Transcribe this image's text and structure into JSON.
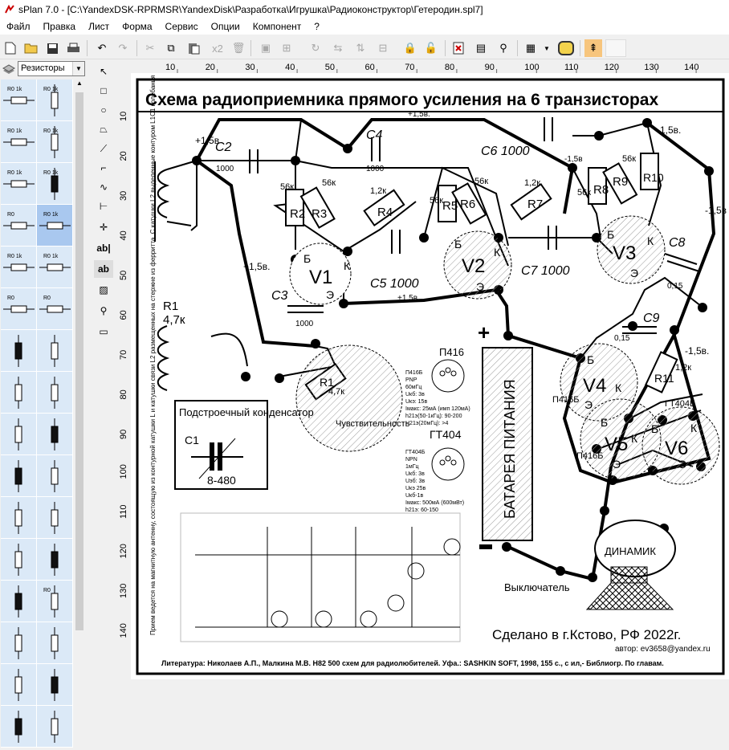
{
  "window": {
    "title": "sPlan 7.0 - [C:\\YandexDSK-RPRMSR\\YandexDisk\\Разработка\\Игрушка\\Радиоконструктор\\Гетеродин.spl7]"
  },
  "menu": [
    "Файл",
    "Правка",
    "Лист",
    "Форма",
    "Сервис",
    "Опции",
    "Компонент",
    "?"
  ],
  "toolbar": {
    "multiply_label": "x2"
  },
  "library": {
    "selected": "Резисторы"
  },
  "left_palette": [
    [
      "R0 1k",
      "R0 1k"
    ],
    [
      "R0 1k",
      "R0 1k"
    ],
    [
      "R0 1k",
      "R0 1k"
    ],
    [
      "R0",
      "R0 1k"
    ],
    [
      "R0 1k",
      "R0 1k"
    ],
    [
      "R0",
      "R0"
    ],
    [
      "",
      ""
    ],
    [
      "",
      ""
    ],
    [
      "",
      ""
    ],
    [
      "",
      ""
    ],
    [
      "",
      ""
    ],
    [
      "",
      ""
    ],
    [
      "",
      "R0"
    ],
    [
      "",
      ""
    ],
    [
      "",
      ""
    ],
    [
      "",
      ""
    ]
  ],
  "rulers": {
    "h": [
      "10",
      "20",
      "30",
      "40",
      "50",
      "60",
      "70",
      "80",
      "90",
      "100",
      "110",
      "120",
      "130",
      "140"
    ],
    "v": [
      "10",
      "20",
      "30",
      "40",
      "50",
      "60",
      "70",
      "80",
      "90",
      "100",
      "110",
      "120",
      "130",
      "140"
    ]
  },
  "schematic": {
    "title": "Схема радиоприемника прямого усиления на 6 транзисторах",
    "supply_top": "+1,5в.",
    "labels": {
      "c2": "C2",
      "c2v": "1000",
      "c4": "C4",
      "c4v": "1000",
      "c6": "C6 1000",
      "c6v": "-1,5в",
      "r2": "R2",
      "r2v": "56к",
      "r3": "R3",
      "r3v": "56к",
      "r4": "R4",
      "r4v": "1,2к",
      "r5": "R5",
      "r5v": "56к",
      "r6": "R6",
      "r6v": "56к",
      "r7": "R7",
      "r7v": "1,2к",
      "r8": "R8",
      "r8v": "56к",
      "r9": "R9",
      "r9v": "56к",
      "r10": "R10",
      "v1": "V1",
      "v2": "V2",
      "v3": "V3",
      "v4": "V4",
      "v5": "V5",
      "v6": "V6",
      "b": "Б",
      "k": "К",
      "e": "Э",
      "c3": "C3",
      "c3v": "1000",
      "c5": "C5 1000",
      "c7": "C7 1000",
      "c8": "C8",
      "c8v": "0,15",
      "c9": "C9",
      "c9v": "0,15",
      "r1": "R1",
      "r1v": "4,7к",
      "r1b": "R1",
      "r1bv": "4,7к",
      "sens": "Чувствительность",
      "r11": "R11",
      "r11v": "1,2к",
      "plus15a": "+1,5в",
      "plus15b": "+1,5в.",
      "plus15c": "+1,5в.",
      "minus15a": "-1,5в.",
      "minus15b": "-1,5в",
      "minus15c": "-1,5в.",
      "p416": "П416",
      "gt404": "ГТ404",
      "p416b_a": "П416Б",
      "p416b_b": "П416Б",
      "gt404b": "ГТ404Б",
      "battery": "БАТАРЕЯ ПИТАНИЯ",
      "switch": "Выключатель",
      "speaker": "ДИНАМИК",
      "trimmer_title": "Подстроечный конденсатор",
      "c1": "C1",
      "c1v": "8-480",
      "spec1": [
        "П416Б",
        "PNP",
        "60мГц",
        "Uкб: 3в",
        "Uкэ: 15в",
        "Iмакс: 25мА (имп 120мА)",
        "h21э(50-1кГц): 90-200",
        "H21э(20мГц): >4"
      ],
      "spec2": [
        "ГТ404Б",
        "NPN",
        "1мГц",
        "Uкб: 3в",
        "Uэб: 3в",
        "Uкэ 25в",
        "Uкб-1в",
        "Iмакс: 500мА (600мВт)",
        "h21э: 60-150"
      ],
      "note": "Прием ведется на магнитную антенну, состоящую из контурной катушки L и катушки связи L2 размещенных на стержне из ферритта. С катушки L2 выделенные контуром L1C1 колебания подаются на переменный резистор",
      "made": "Сделано в г.Кстово, РФ 2022г.",
      "author": "автор: ev3658@yandex.ru",
      "literature": "Литература: Николаев А.П., Малкина М.В. Н82 500 схем для радиолюбителей. Уфа.: SASHKIN SOFT, 1998, 155 с., с ил,- Библиогр. По главам."
    }
  }
}
